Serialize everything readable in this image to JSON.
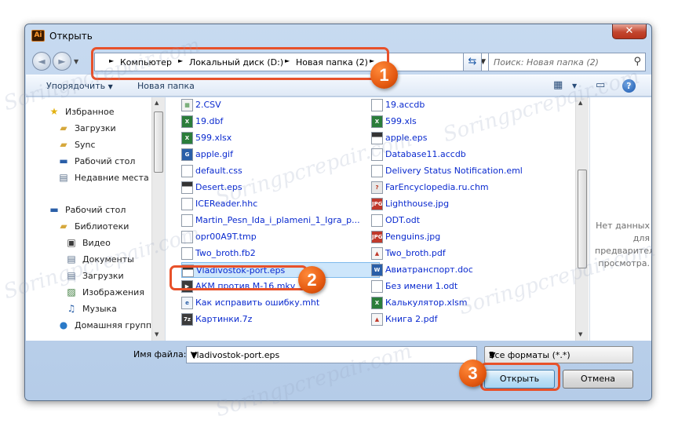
{
  "window": {
    "title": "Открыть",
    "app_icon_text": "Ai",
    "close_glyph": "✕"
  },
  "address": {
    "crumbs": [
      "Компьютер",
      "Локальный диск (D:)",
      "Новая папка (2)"
    ],
    "search_placeholder": "Поиск: Новая папка (2)"
  },
  "toolbar": {
    "organize_label": "Упорядочить",
    "new_folder_label": "Новая папка"
  },
  "sidebar": {
    "items": [
      {
        "label": "Избранное",
        "icon": "star-icon"
      },
      {
        "label": "Загрузки",
        "icon": "downloads-folder-icon"
      },
      {
        "label": "Sync",
        "icon": "sync-folder-icon"
      },
      {
        "label": "Рабочий стол",
        "icon": "desktop-icon"
      },
      {
        "label": "Недавние места",
        "icon": "recent-places-icon"
      },
      {
        "label": "Рабочий стол",
        "icon": "desktop-icon"
      },
      {
        "label": "Библиотеки",
        "icon": "libraries-icon"
      },
      {
        "label": "Видео",
        "icon": "video-icon"
      },
      {
        "label": "Документы",
        "icon": "documents-icon"
      },
      {
        "label": "Загрузки",
        "icon": "downloads-icon"
      },
      {
        "label": "Изображения",
        "icon": "pictures-icon"
      },
      {
        "label": "Музыка",
        "icon": "music-icon"
      },
      {
        "label": "Домашняя группа",
        "icon": "homegroup-icon"
      }
    ]
  },
  "files": {
    "col1": [
      {
        "name": "2.CSV",
        "type": "csv"
      },
      {
        "name": "19.dbf",
        "type": "excel"
      },
      {
        "name": "599.xlsx",
        "type": "excel"
      },
      {
        "name": "apple.gif",
        "type": "gif"
      },
      {
        "name": "default.css",
        "type": "doc"
      },
      {
        "name": "Desert.eps",
        "type": "eps"
      },
      {
        "name": "ICEReader.hhc",
        "type": "doc"
      },
      {
        "name": "Martin_Pesn_Ida_i_plameni_1_Igra_p...",
        "type": "doc"
      },
      {
        "name": "opr00A9T.tmp",
        "type": "doc"
      },
      {
        "name": "Two_broth.fb2",
        "type": "doc"
      },
      {
        "name": "Vladivostok-port.eps",
        "type": "eps"
      },
      {
        "name": "АКМ против М-16.mkv",
        "type": "mkv"
      },
      {
        "name": "Как исправить ошибку.mht",
        "type": "mht"
      },
      {
        "name": "Картинки.7z",
        "type": "archive"
      }
    ],
    "col2": [
      {
        "name": "19.accdb",
        "type": "doc"
      },
      {
        "name": "599.xls",
        "type": "excel"
      },
      {
        "name": "apple.eps",
        "type": "eps"
      },
      {
        "name": "Database11.accdb",
        "type": "doc"
      },
      {
        "name": "Delivery Status Notification.eml",
        "type": "doc"
      },
      {
        "name": "FarEncyclopedia.ru.chm",
        "type": "chm"
      },
      {
        "name": "Lighthouse.jpg",
        "type": "jpg"
      },
      {
        "name": "ODT.odt",
        "type": "doc"
      },
      {
        "name": "Penguins.jpg",
        "type": "jpg"
      },
      {
        "name": "Two_broth.pdf",
        "type": "pdf"
      },
      {
        "name": "Авиатранспорт.doc",
        "type": "word"
      },
      {
        "name": "Без имени 1.odt",
        "type": "doc"
      },
      {
        "name": "Калькулятор.xlsm",
        "type": "excel"
      },
      {
        "name": "Книга 2.pdf",
        "type": "pdf"
      }
    ]
  },
  "preview": {
    "text": "Нет данных для предварительного просмотра."
  },
  "footer": {
    "filename_label": "Имя файла:",
    "filename_value": "Vladivostok-port.eps",
    "format_value": "Все форматы (*.*)",
    "open_label": "Открыть",
    "cancel_label": "Отмена"
  },
  "markers": [
    "1",
    "2",
    "3"
  ],
  "watermark_text": "Soringpcrepair.com",
  "colors": {
    "accent": "#e8512a",
    "link": "#0a2acf",
    "selection": "#cde6fb"
  }
}
